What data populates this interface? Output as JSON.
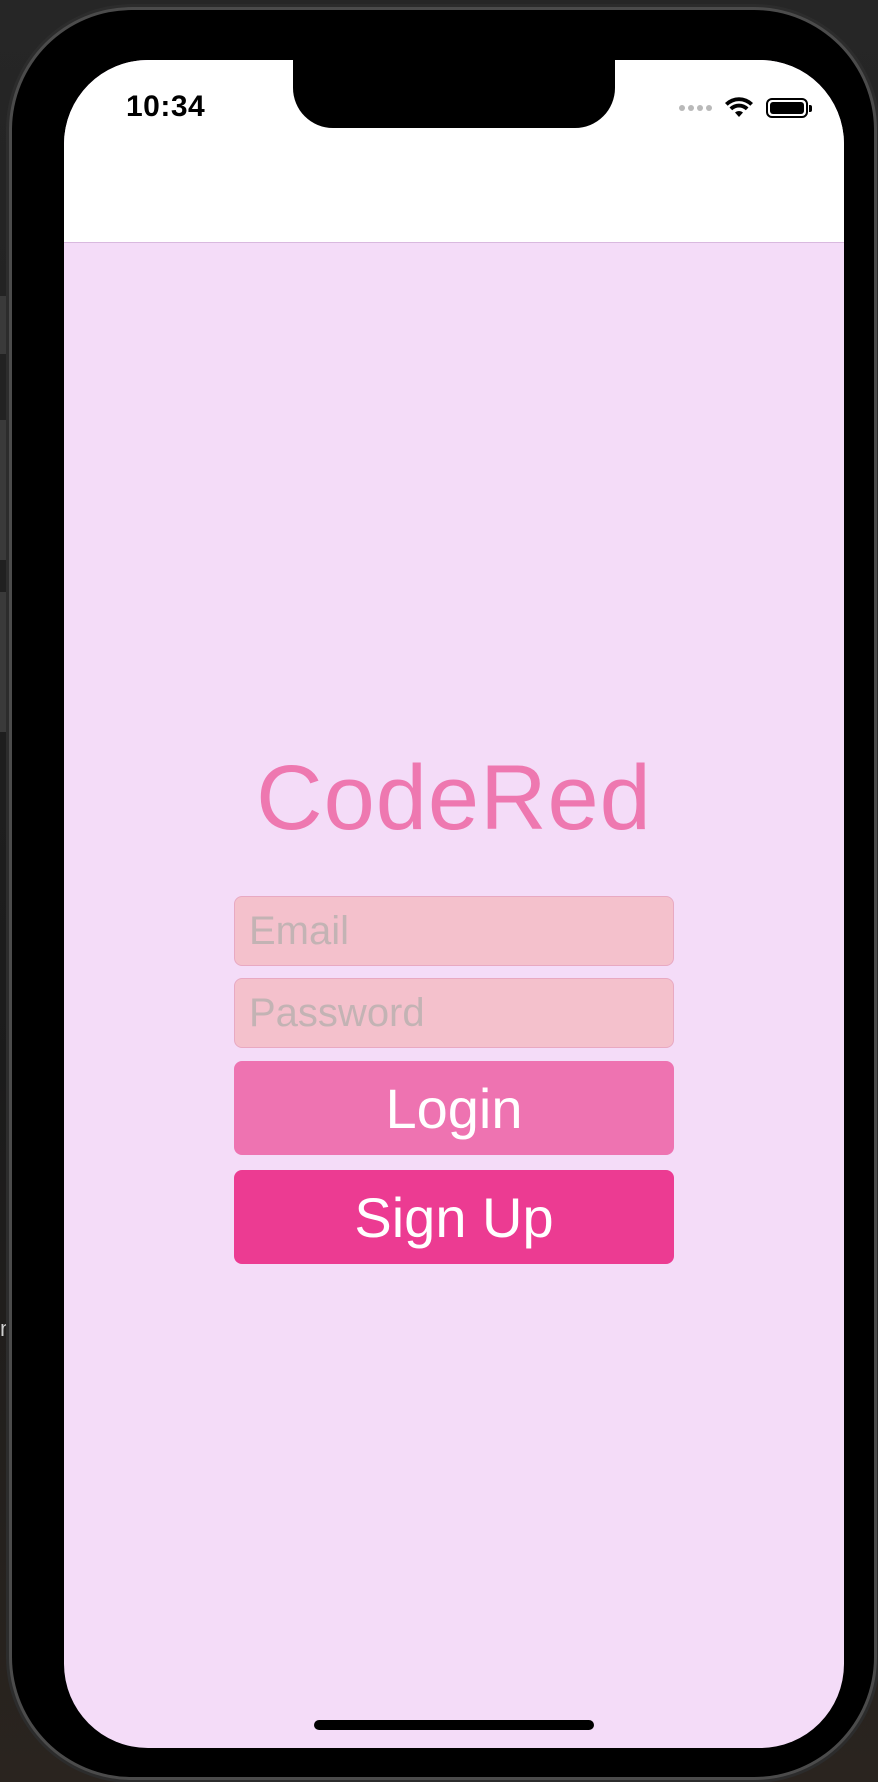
{
  "status_bar": {
    "time": "10:34"
  },
  "app": {
    "title": "CodeRed",
    "title_color": "#ee78b0",
    "background_color": "#f4dcf8"
  },
  "form": {
    "email_placeholder": "Email",
    "email_value": "",
    "password_placeholder": "Password",
    "password_value": "",
    "field_color": "#f4c1cc"
  },
  "buttons": {
    "login_label": "Login",
    "login_color": "#ee73b1",
    "signup_label": "Sign Up",
    "signup_color": "#ec3b92"
  },
  "icons": {
    "signal": "cellular-signal-icon",
    "wifi": "wifi-icon",
    "battery": "battery-icon"
  },
  "backdrop": {
    "side_text": "m"
  }
}
